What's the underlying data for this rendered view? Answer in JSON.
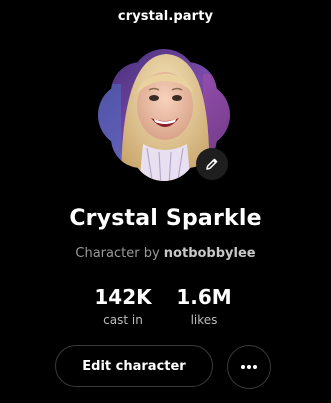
{
  "header": {
    "site_name": "crystal.party"
  },
  "profile": {
    "display_name": "Crystal Sparkle",
    "byline_prefix": "Character by",
    "author": "notbobbylee",
    "avatar_icon": "photo-avatar",
    "edit_avatar_icon": "pencil-icon"
  },
  "stats": [
    {
      "value": "142K",
      "label": "cast in"
    },
    {
      "value": "1.6M",
      "label": "likes"
    }
  ],
  "actions": {
    "edit_label": "Edit character",
    "more_icon": "ellipsis-icon"
  },
  "colors": {
    "background": "#000000",
    "text_primary": "#ffffff",
    "text_secondary": "#9a9a9a",
    "button_border": "#3a3a3a"
  }
}
